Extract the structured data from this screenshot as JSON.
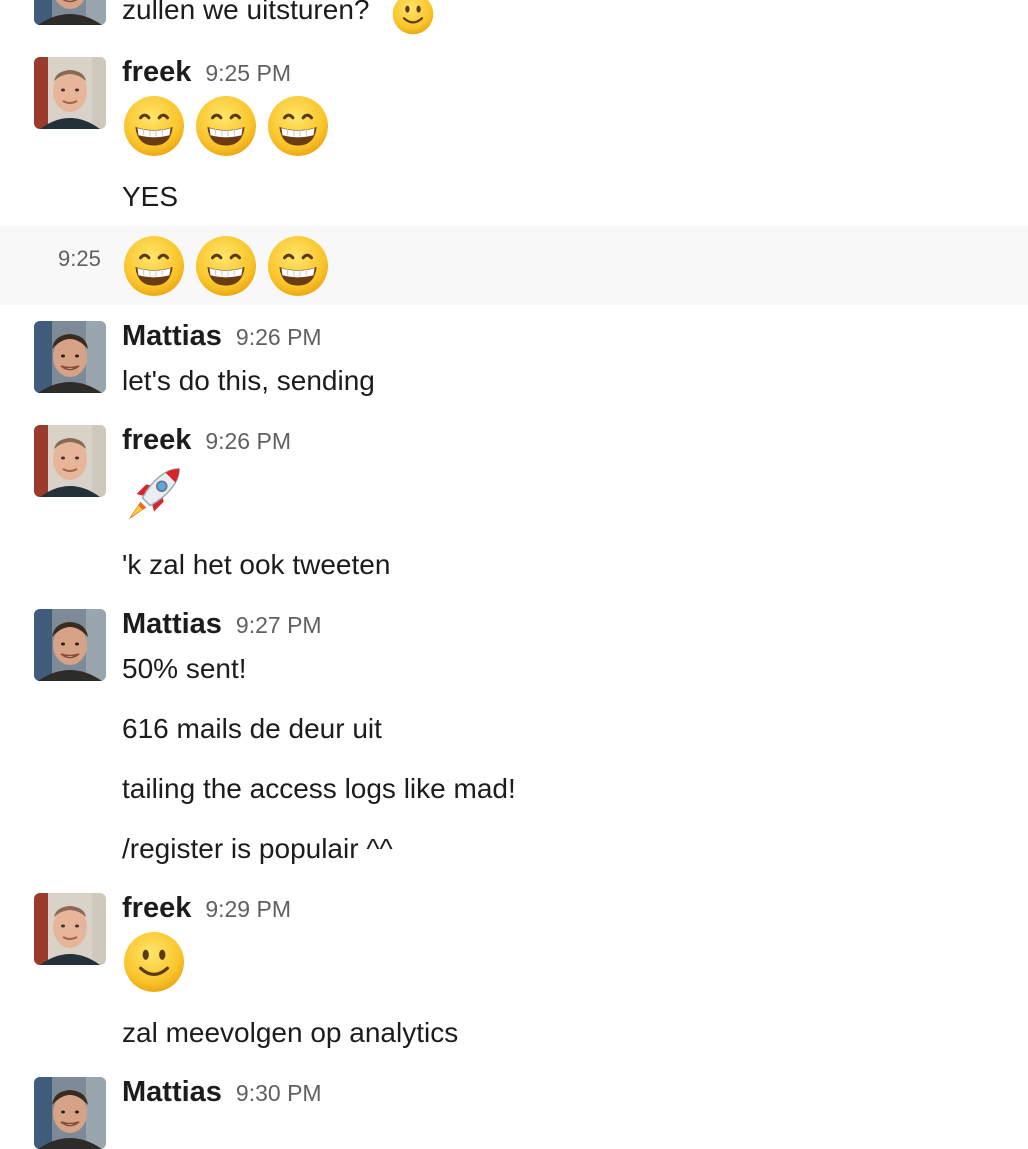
{
  "messages": {
    "top_partial": {
      "text": "zullen we uitsturen?"
    },
    "m1": {
      "author": "freek",
      "time": "9:25 PM",
      "line1": "YES"
    },
    "m1b": {
      "side_time": "9:25"
    },
    "m2": {
      "author": "Mattias",
      "time": "9:26 PM",
      "line1": "let's do this, sending"
    },
    "m3": {
      "author": "freek",
      "time": "9:26 PM",
      "line1": "'k zal het ook tweeten"
    },
    "m4": {
      "author": "Mattias",
      "time": "9:27 PM",
      "line1": "50% sent!",
      "line2": "616 mails de deur uit",
      "line3": "tailing the access logs like mad!",
      "line4": "/register is populair ^^"
    },
    "m5": {
      "author": "freek",
      "time": "9:29 PM",
      "line1": "zal meevolgen op analytics"
    },
    "m6": {
      "author": "Mattias",
      "time": "9:30 PM"
    }
  },
  "icons": [
    "slightly-smiling-face-emoji",
    "grinning-face-emoji",
    "rocket-emoji",
    "avatar-freek",
    "avatar-mattias"
  ],
  "colors": {
    "text": "#1d1c1d",
    "muted": "#616061",
    "hover_bg": "#f8f8f8",
    "emoji_yellow": "#f7c531"
  }
}
